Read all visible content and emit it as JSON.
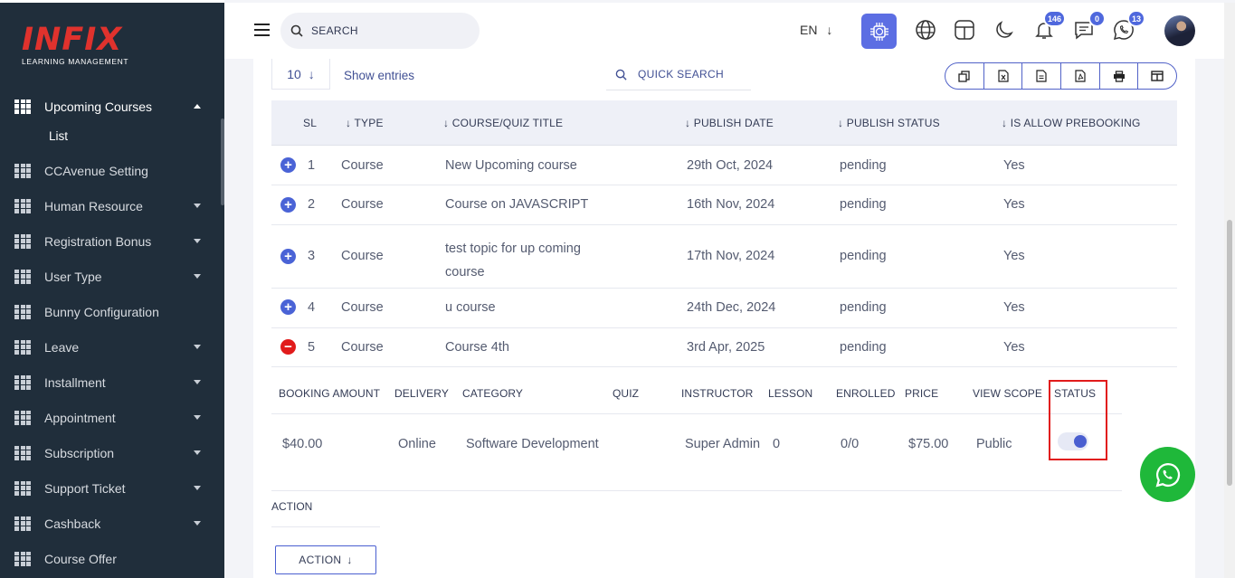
{
  "brand": {
    "logo": "INFIX",
    "subtitle": "LEARNING MANAGEMENT"
  },
  "sidebar": {
    "items": [
      {
        "label": "Upcoming Courses",
        "icon": "grid-icon",
        "expanded": true
      },
      {
        "label": "CCAvenue Setting",
        "icon": "grid-icon"
      },
      {
        "label": "Human Resource",
        "icon": "grid-icon"
      },
      {
        "label": "Registration Bonus",
        "icon": "grid-icon"
      },
      {
        "label": "User Type",
        "icon": "grid-icon"
      },
      {
        "label": "Bunny Configuration",
        "icon": "grid-icon"
      },
      {
        "label": "Leave",
        "icon": "grid-icon"
      },
      {
        "label": "Installment",
        "icon": "grid-icon"
      },
      {
        "label": "Appointment",
        "icon": "grid-icon"
      },
      {
        "label": "Subscription",
        "icon": "grid-icon"
      },
      {
        "label": "Support Ticket",
        "icon": "grid-icon"
      },
      {
        "label": "Cashback",
        "icon": "grid-icon"
      },
      {
        "label": "Course Offer",
        "icon": "grid-icon"
      }
    ],
    "sub_item": "List"
  },
  "topbar": {
    "search_placeholder": "SEARCH",
    "language": "EN",
    "notifications_count": "146",
    "messages_count": "0",
    "chat_count": "13"
  },
  "table_controls": {
    "entries_value": "10",
    "show_entries": "Show entries",
    "quick_search": "QUICK SEARCH"
  },
  "table": {
    "headers": [
      "SL",
      "TYPE",
      "COURSE/QUIZ TITLE",
      "PUBLISH DATE",
      "PUBLISH STATUS",
      "IS ALLOW PREBOOKING"
    ],
    "rows": [
      {
        "sl": "1",
        "type": "Course",
        "title": "New Upcoming course",
        "date": "29th Oct, 2024",
        "status": "pending",
        "prebook": "Yes"
      },
      {
        "sl": "2",
        "type": "Course",
        "title": "Course on JAVASCRIPT",
        "date": "16th Nov, 2024",
        "status": "pending",
        "prebook": "Yes"
      },
      {
        "sl": "3",
        "type": "Course",
        "title": "test topic for up coming course",
        "title_line1": "test topic for up coming",
        "title_line2": "course",
        "date": "17th Nov, 2024",
        "status": "pending",
        "prebook": "Yes"
      },
      {
        "sl": "4",
        "type": "Course",
        "title": "u course",
        "date": "24th Dec, 2024",
        "status": "pending",
        "prebook": "Yes"
      },
      {
        "sl": "5",
        "type": "Course",
        "title": "Course 4th",
        "date": "3rd Apr, 2025",
        "status": "pending",
        "prebook": "Yes"
      }
    ]
  },
  "detail": {
    "headers": [
      "BOOKING AMOUNT",
      "DELIVERY",
      "CATEGORY",
      "QUIZ",
      "INSTRUCTOR",
      "LESSON",
      "ENROLLED",
      "PRICE",
      "VIEW SCOPE",
      "STATUS"
    ],
    "values": {
      "booking_amount": "$40.00",
      "delivery": "Online",
      "category": "Software Development",
      "quiz": "",
      "instructor": "Super Admin",
      "lesson": "0",
      "enrolled": "0/0",
      "price": "$75.00",
      "view_scope": "Public",
      "status_on": true
    },
    "action_header": "ACTION",
    "action_button": "ACTION"
  },
  "colors": {
    "sidebar_bg": "#202e3b",
    "accent": "#4a5fd0",
    "highlight": "#e11b1b",
    "whatsapp": "#1fb83a"
  }
}
